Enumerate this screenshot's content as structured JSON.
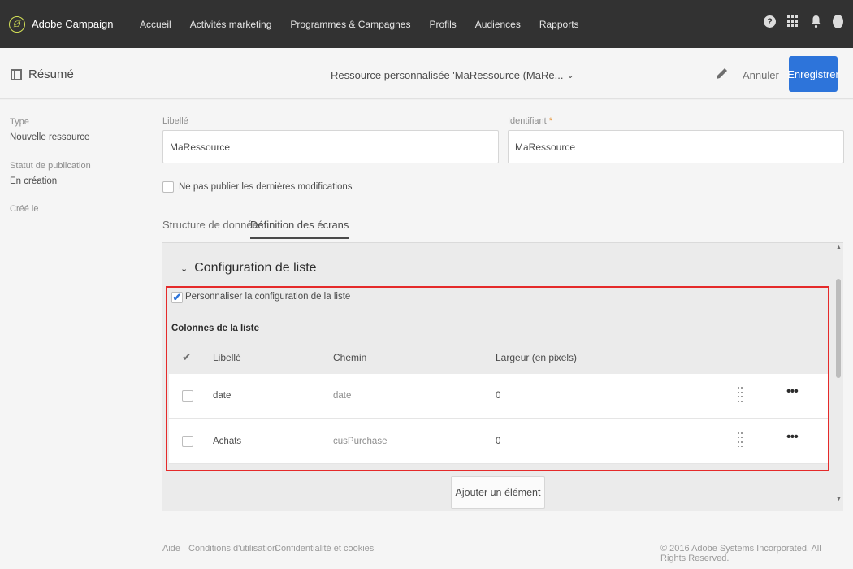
{
  "topbar": {
    "brand_glyph": "Ø",
    "brand": "Adobe Campaign",
    "nav": [
      "Accueil",
      "Activités marketing",
      "Programmes & Campagnes",
      "Profils",
      "Audiences",
      "Rapports"
    ],
    "help_glyph": "?"
  },
  "header": {
    "summary_label": "Résumé",
    "title": "Ressource personnalisée 'MaRessource (MaRe...",
    "chevron": "⌄",
    "cancel_label": "Annuler",
    "save_label": "Enregistrer"
  },
  "sidebar": {
    "type_label": "Type",
    "type_value": "Nouvelle ressource",
    "status_label": "Statut de publication",
    "status_value": "En création",
    "created_label": "Créé le"
  },
  "form": {
    "label_field": {
      "label": "Libellé",
      "value": "MaRessource"
    },
    "id_field": {
      "label": "Identifiant",
      "required_mark": "*",
      "value": "MaRessource"
    },
    "no_publish_label": "Ne pas publier les dernières modifications"
  },
  "tabs": [
    {
      "label": "Structure de données",
      "active": false
    },
    {
      "label": "Définition des écrans",
      "active": true
    }
  ],
  "list_config": {
    "section_chevron": "⌄",
    "section_title": "Configuration de liste",
    "customize_label": "Personnaliser la configuration de la liste",
    "customize_checked": true,
    "check_mark": "✔",
    "columns_title": "Colonnes de la liste",
    "header_check": "✔",
    "headers": {
      "label": "Libellé",
      "path": "Chemin",
      "width": "Largeur (en pixels)"
    },
    "rows": [
      {
        "label": "date",
        "path": "date",
        "width": "0"
      },
      {
        "label": "Achats",
        "path": "cusPurchase",
        "width": "0"
      }
    ],
    "more_glyph": "•••",
    "add_button_label": "Ajouter un élément"
  },
  "scrollbar": {
    "up": "▲",
    "down": "▼"
  },
  "footer": {
    "links": [
      "Aide",
      "Conditions d'utilisation",
      "Confidentialité et cookies"
    ],
    "copyright": "© 2016 Adobe Systems Incorporated. All Rights Reserved."
  },
  "colors": {
    "accent": "#2d74da",
    "highlight_frame": "#e52a2a",
    "topbar": "#323232"
  }
}
